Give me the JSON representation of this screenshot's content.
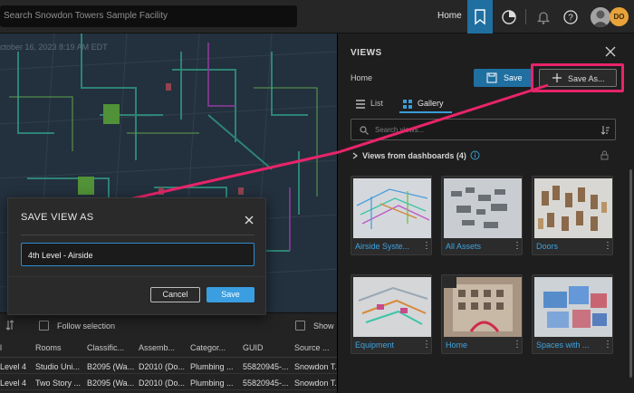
{
  "topbar": {
    "search_placeholder": "Search Snowdon Towers Sample Facility",
    "home_label": "Home",
    "avatar_initials": "DO",
    "icons": [
      "bookmark-icon",
      "dashboard-icon",
      "bell-icon",
      "help-icon",
      "avatar-icon"
    ]
  },
  "viewport": {
    "timestamp_ghost": "ctober 16, 2023 8:19 AM EDT"
  },
  "table": {
    "follow_selection_label": "Follow selection",
    "show_label": "Show",
    "columns": [
      "l",
      "Rooms",
      "Classific...",
      "Assemb...",
      "Categor...",
      "GUID",
      "Source ..."
    ],
    "rows": [
      [
        "Level 4",
        "Studio Uni...",
        "B2095 (Wa...",
        "D2010 (Do...",
        "Plumbing ...",
        "55820945-...",
        "Snowdon T..."
      ],
      [
        "Level 4",
        "Two Story ...",
        "B2095 (Wa...",
        "D2010 (Do...",
        "Plumbing ...",
        "55820945-...",
        "Snowdon T..."
      ]
    ]
  },
  "views_panel": {
    "title": "VIEWS",
    "current_view": "Home",
    "save_label": "Save",
    "save_as_label": "Save As...",
    "tab_list": "List",
    "tab_gallery": "Gallery",
    "search_placeholder": "Search views...",
    "section_title": "Views from dashboards (4)",
    "cards": [
      {
        "label": "Airside Syste...",
        "thumb": "pipes"
      },
      {
        "label": "All Assets",
        "thumb": "assets"
      },
      {
        "label": "Doors",
        "thumb": "doors"
      },
      {
        "label": "Equipment",
        "thumb": "equipment"
      },
      {
        "label": "Home",
        "thumb": "home"
      },
      {
        "label": "Spaces with ...",
        "thumb": "spaces"
      }
    ]
  },
  "dialog": {
    "title": "SAVE VIEW AS",
    "input_value": "4th Level - Airside",
    "cancel_label": "Cancel",
    "save_label": "Save"
  },
  "colors": {
    "accent": "#1f6fa0",
    "callout": "#e8246a",
    "link": "#3ea3e0"
  }
}
